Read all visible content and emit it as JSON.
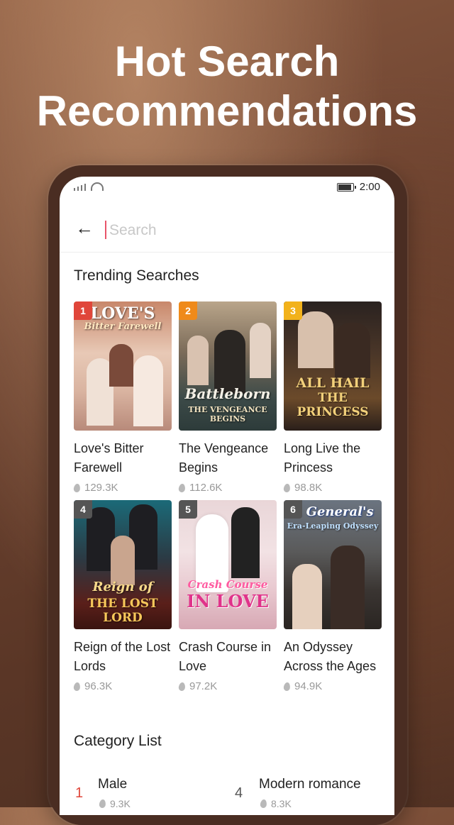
{
  "headline": {
    "line1": "Hot Search",
    "line2": "Recommendations"
  },
  "status_bar": {
    "time": "2:00"
  },
  "search": {
    "placeholder": "Search",
    "value": ""
  },
  "trending": {
    "title": "Trending Searches",
    "items": [
      {
        "rank": "1",
        "title": "Love's Bitter Farewell",
        "heat": "129.3K",
        "poster_text_top": "LOVE'S",
        "poster_text_sub": "Bitter Farewell",
        "rank_color": "#e0463a"
      },
      {
        "rank": "2",
        "title": "The Vengeance Begins",
        "heat": "112.6K",
        "poster_text_top": "Battleborn",
        "poster_text_sub": "THE VENGEANCE BEGINS",
        "rank_color": "#ef8a1a"
      },
      {
        "rank": "3",
        "title": "Long Live the Princess",
        "heat": "98.8K",
        "poster_text_top": "ALL HAIL",
        "poster_text_sub": "THE PRINCESS",
        "rank_color": "#f2b21b"
      },
      {
        "rank": "4",
        "title": "Reign of the Lost Lords",
        "heat": "96.3K",
        "poster_text_top": "Reign of",
        "poster_text_sub": "THE LOST LORD",
        "rank_color": "#555555"
      },
      {
        "rank": "5",
        "title": "Crash Course in Love",
        "heat": "97.2K",
        "poster_text_top": "Crash Course",
        "poster_text_sub": "IN LOVE",
        "rank_color": "#555555"
      },
      {
        "rank": "6",
        "title": "An Odyssey Across the Ages",
        "heat": "94.9K",
        "poster_text_top": "A General's",
        "poster_text_sub": "Era-Leaping Odyssey",
        "rank_color": "#555555"
      }
    ]
  },
  "category": {
    "title": "Category List",
    "items": [
      {
        "rank": "1",
        "label": "Male",
        "heat": "9.3K",
        "rank_color": "#e0463a"
      },
      {
        "rank": "4",
        "label": "Modern romance",
        "heat": "8.3K",
        "rank_color": "#555555"
      }
    ]
  }
}
